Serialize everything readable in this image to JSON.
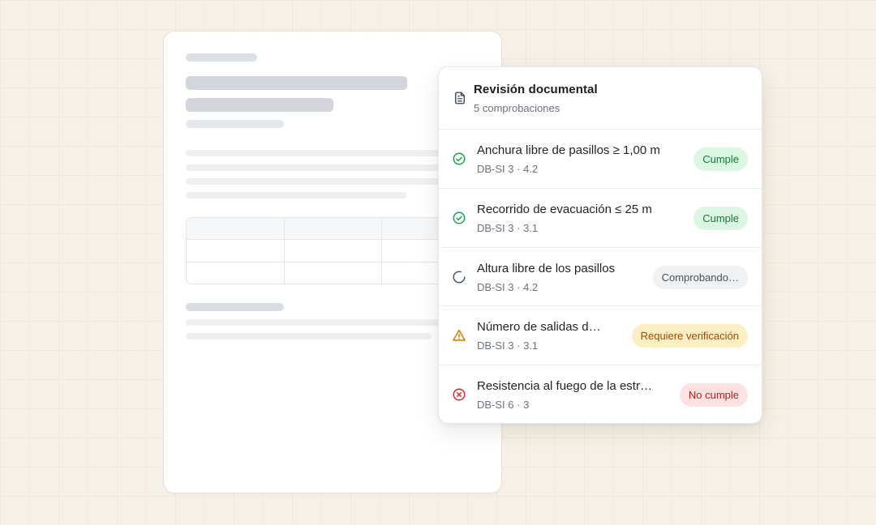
{
  "panel": {
    "icon": "document-icon",
    "title": "Revisión documental",
    "subtitle": "5 comprobaciones"
  },
  "checks": [
    {
      "title": "Anchura libre de pasillos ≥ 1,00 m",
      "ref": "DB-SI 3 · 4.2",
      "status": "Cumple",
      "icon": "check-circle-icon",
      "color": "#16a34a"
    },
    {
      "title": "Recorrido de evacuación ≤ 25 m",
      "ref": "DB-SI 3 · 3.1",
      "status": "Cumple",
      "icon": "check-circle-icon",
      "color": "#16a34a"
    },
    {
      "title": "Altura libre de los pasillos",
      "ref": "DB-SI 3 · 4.2",
      "status": "Comprobando…",
      "icon": "spinner-icon",
      "color": "#4b5563"
    },
    {
      "title": "Número de salidas d…",
      "ref": "DB-SI 3 · 3.1",
      "status": "Requiere verificación",
      "icon": "warning-triangle-icon",
      "color": "#d97706"
    },
    {
      "title": "Resistencia al fuego de la estr…",
      "ref": "DB-SI 6 · 3",
      "status": "No cumple",
      "icon": "x-circle-icon",
      "color": "#dc2626"
    }
  ]
}
